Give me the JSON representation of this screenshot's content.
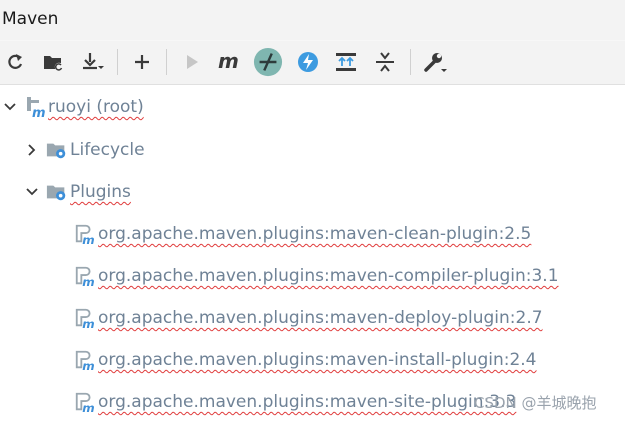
{
  "window": {
    "title": "Maven"
  },
  "toolbar": {
    "buttons": [
      {
        "name": "reload-all-maven-projects",
        "icon": "refresh-icon"
      },
      {
        "name": "generate-sources-and-update-folders",
        "icon": "folder-refresh-icon"
      },
      {
        "name": "download-sources-and-docs",
        "icon": "download-icon"
      },
      {
        "name": "add-maven-projects",
        "icon": "plus-icon"
      },
      {
        "name": "run-maven-build",
        "icon": "play-icon"
      },
      {
        "name": "execute-maven-goal",
        "icon": "maven-m-icon"
      },
      {
        "name": "toggle-offline-mode",
        "icon": "offline-toggle-icon"
      },
      {
        "name": "toggle-skip-tests-mode",
        "icon": "lightning-icon"
      },
      {
        "name": "show-dependencies",
        "icon": "dependencies-icon"
      },
      {
        "name": "collapse-all",
        "icon": "collapse-all-icon"
      },
      {
        "name": "maven-settings",
        "icon": "wrench-icon"
      }
    ]
  },
  "tree": {
    "root": {
      "label": "ruoyi (root)"
    },
    "lifecycle": {
      "label": "Lifecycle"
    },
    "plugins": {
      "label": "Plugins"
    },
    "plugin_items": [
      "org.apache.maven.plugins:maven-clean-plugin:2.5",
      "org.apache.maven.plugins:maven-compiler-plugin:3.1",
      "org.apache.maven.plugins:maven-deploy-plugin:2.7",
      "org.apache.maven.plugins:maven-install-plugin:2.4",
      "org.apache.maven.plugins:maven-site-plugin:3.3"
    ]
  },
  "watermark": "CSDN @羊城晚抱",
  "colors": {
    "tree_text": "#6f8296",
    "maven_blue": "#3d8fd8",
    "folder_gray": "#9aa7b0",
    "spellcheck_red": "#e03b3b",
    "toggle_active": "#7fb6b0"
  }
}
